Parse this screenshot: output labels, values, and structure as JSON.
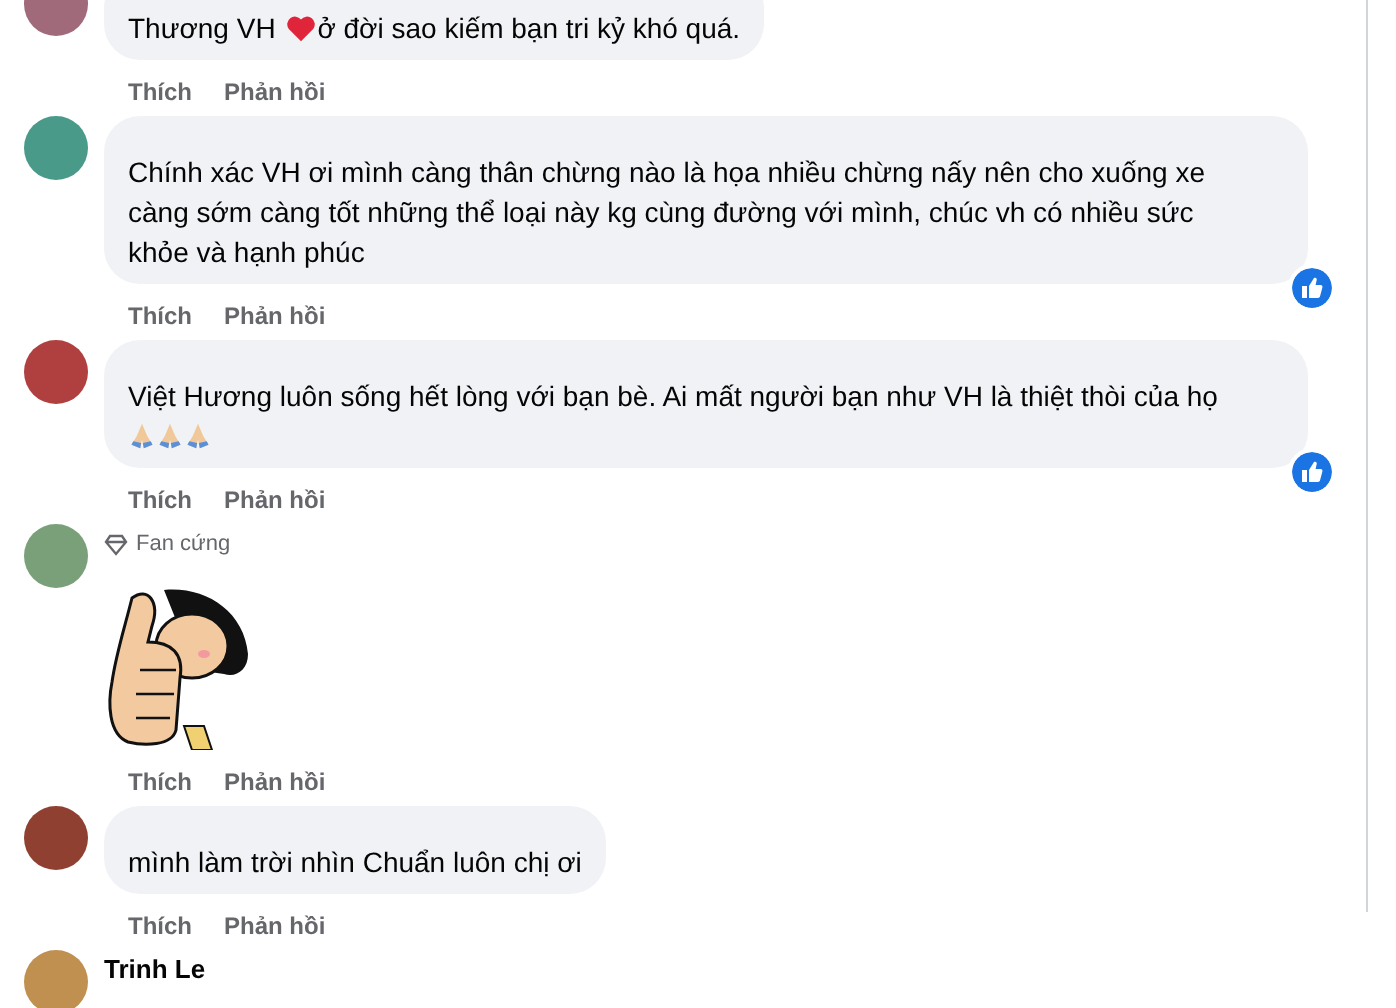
{
  "comments": [
    {
      "kind": "text",
      "segments": [
        {
          "kind": "text",
          "text": "Thương VH "
        },
        {
          "kind": "heart"
        },
        {
          "kind": "text",
          "text": "ở đời sao kiếm bạn tri kỷ khó quá."
        }
      ],
      "reacted": false,
      "actions": [
        "Thích",
        "Phản hồi"
      ]
    },
    {
      "kind": "text",
      "segments": [
        {
          "kind": "text",
          "text": "Chính xác VH ơi mình càng thân chừng nào là họa nhiều chừng nấy nên cho xuống xe càng sớm càng tốt những thể loại này kg cùng đường với mình, chúc vh có nhiều sức khỏe và hạnh phúc"
        }
      ],
      "reacted": true,
      "actions": [
        "Thích",
        "Phản hồi"
      ]
    },
    {
      "kind": "text",
      "segments": [
        {
          "kind": "text",
          "text": "Việt Hương luôn sống hết lòng với bạn bè. Ai mất người bạn như VH là thiệt thòi của họ"
        },
        {
          "kind": "pray"
        },
        {
          "kind": "pray"
        },
        {
          "kind": "pray"
        }
      ],
      "reacted": true,
      "actions": [
        "Thích",
        "Phản hồi"
      ]
    },
    {
      "kind": "sticker",
      "badge": "Fan cứng",
      "reacted": false,
      "actions": [
        "Thích",
        "Phản hồi"
      ]
    },
    {
      "kind": "text",
      "segments": [
        {
          "kind": "text",
          "text": "mình làm trời nhìn Chuẩn luôn chị ơi"
        }
      ],
      "reacted": false,
      "actions": [
        "Thích",
        "Phản hồi"
      ]
    },
    {
      "kind": "name_only",
      "name": "Trinh Le"
    }
  ]
}
